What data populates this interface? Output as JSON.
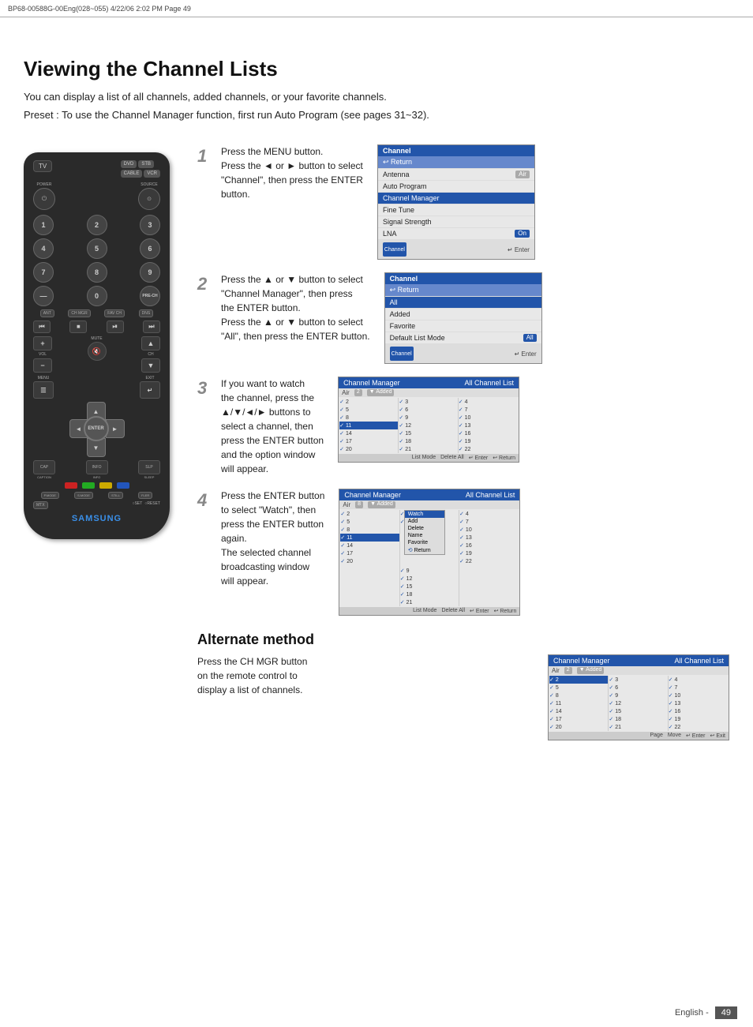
{
  "header": {
    "text": "BP68-00588G-00Eng(028~055)   4/22/06   2:02 PM   Page 49"
  },
  "page": {
    "title": "Viewing the Channel Lists",
    "intro": "You can display a list of all channels, added channels, or your favorite channels.",
    "preset": "Preset : To use the Channel Manager function, first run Auto Program (see pages 31~32).",
    "page_number": "English - 49"
  },
  "steps": [
    {
      "number": "1",
      "text_line1": "Press the MENU button.",
      "text_line2": "Press the ◄ or ► button to select",
      "text_line3": "\"Channel\", then press the ENTER",
      "text_line4": "button."
    },
    {
      "number": "2",
      "text_line1": "Press the ▲ or ▼ button to select",
      "text_line2": "\"Channel Manager\", then press",
      "text_line3": "the ENTER button.",
      "text_line4": "Press the ▲ or ▼ button to select",
      "text_line5": "\"All\", then press the ENTER button."
    },
    {
      "number": "3",
      "text_line1": "If you want to watch",
      "text_line2": "the channel, press the",
      "text_line3": "▲/▼/◄/► buttons to",
      "text_line4": "select a channel, then",
      "text_line5": "press the ENTER button",
      "text_line6": "and the option window",
      "text_line7": "will appear."
    },
    {
      "number": "4",
      "text_line1": "Press the ENTER button",
      "text_line2": "to select \"Watch\", then",
      "text_line3": "press the ENTER button",
      "text_line4": "again.",
      "text_line5": "The selected channel",
      "text_line6": "broadcasting window",
      "text_line7": "will appear."
    }
  ],
  "alternate_method": {
    "title": "Alternate method",
    "text_line1": "Press the CH MGR button",
    "text_line2": "on the remote control to",
    "text_line3": "display a list of channels."
  },
  "channel_menu_1": {
    "header": "Channel",
    "items": [
      {
        "label": "↩ Return",
        "value": "",
        "type": "return"
      },
      {
        "label": "Antenna",
        "value": "Air",
        "type": "normal"
      },
      {
        "label": "Auto Program",
        "value": "",
        "type": "normal"
      },
      {
        "label": "Channel Manager",
        "value": "",
        "type": "normal"
      },
      {
        "label": "Fine Tune",
        "value": "",
        "type": "normal"
      },
      {
        "label": "Signal Strength",
        "value": "",
        "type": "normal"
      },
      {
        "label": "LNA",
        "value": "On",
        "type": "normal"
      }
    ],
    "icon_label": "Channel",
    "footer": "↵ Enter"
  },
  "channel_menu_2": {
    "header": "Channel",
    "items": [
      {
        "label": "↩ Return",
        "value": "",
        "type": "return"
      },
      {
        "label": "All",
        "value": "",
        "type": "normal"
      },
      {
        "label": "Added",
        "value": "",
        "type": "normal"
      },
      {
        "label": "Favorite",
        "value": "",
        "type": "normal"
      },
      {
        "label": "Default List Mode",
        "value": "All",
        "type": "normal"
      }
    ],
    "icon_label": "Channel",
    "footer": "↵ Enter"
  },
  "channel_manager_3": {
    "header_left": "Channel Manager",
    "header_right": "All Channel List",
    "sub_air": "Air",
    "sub_ch": "2",
    "sub_added": "Added",
    "columns": [
      [
        2,
        5,
        8,
        11,
        14,
        17,
        20
      ],
      [
        3,
        6,
        9,
        12,
        15,
        18,
        21
      ],
      [
        4,
        7,
        10,
        13,
        16,
        19,
        22
      ]
    ],
    "highlighted_row": 8,
    "footer_items": [
      "List Mode",
      "Delete All",
      "↵ Enter",
      "↩ Return"
    ]
  },
  "channel_manager_4": {
    "header_left": "Channel Manager",
    "header_right": "All Channel List",
    "sub_air": "Air",
    "sub_ch": "8",
    "sub_added": "Added",
    "popup_items": [
      "Watch",
      "Add",
      "Delete",
      "Name",
      "Favorite",
      "Return"
    ],
    "footer_items": [
      "List Mode",
      "Delete All",
      "↵ Enter",
      "↩ Return"
    ]
  },
  "channel_manager_alt": {
    "header_left": "Channel Manager",
    "header_right": "All Channel List",
    "sub_air": "Air",
    "sub_ch": "2",
    "sub_added": "Added",
    "footer_items": [
      "Page",
      "Move",
      "Enter",
      "Exit"
    ]
  },
  "remote": {
    "samsung_label": "SAMSUNG",
    "buttons": {
      "tv": "TV",
      "dvd": "DVD",
      "stb": "STB",
      "cable": "CABLE",
      "vcr": "VCR",
      "power": "POWER",
      "source": "SOURCE",
      "nums": [
        "1",
        "2",
        "3",
        "4",
        "5",
        "6",
        "7",
        "8",
        "9",
        "-",
        "0",
        "PRE-CH"
      ],
      "antenna": "ANTENNA",
      "ch_mgr": "CH MGR",
      "fav_ch": "FAV CH",
      "dns": "DNS",
      "rew": "REW",
      "stop": "STOP",
      "play": "▶⏸",
      "ff": "FF",
      "vol": "VOL",
      "ch": "CH",
      "mute": "MUTE",
      "menu": "MENU",
      "exit": "EXIT",
      "enter": "ENTER",
      "caption": "CAPTION",
      "info": "INFO",
      "sleep": "SLEEP",
      "p_mode": "P.MODE",
      "s_mode": "S.MODE",
      "still": "STILL",
      "fler": "FLER",
      "mtx": "MTX",
      "set": "SET",
      "reset": "RESET"
    }
  }
}
